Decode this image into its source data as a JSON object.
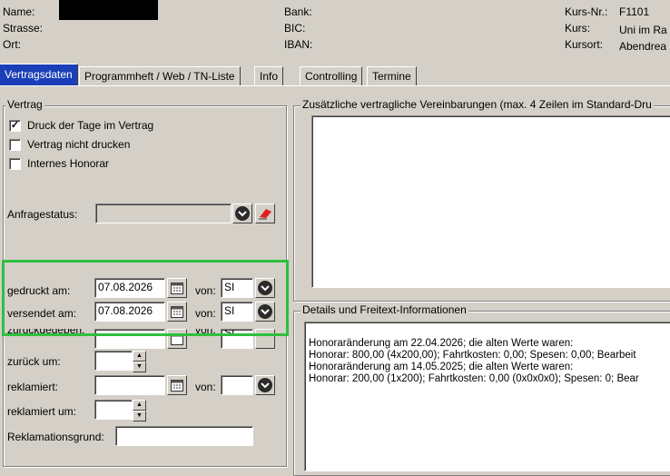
{
  "header": {
    "name_label": "Name:",
    "strasse_label": "Strasse:",
    "ort_label": "Ort:",
    "bank_label": "Bank:",
    "bic_label": "BIC:",
    "iban_label": "IBAN:",
    "kursnr_label": "Kurs-Nr.:",
    "kursnr_value": "F1101",
    "kurs_label": "Kurs:",
    "kurs_value": "Uni im Ra",
    "kursort_label": "Kursort:",
    "kursort_value": "Abendrea"
  },
  "tabs": [
    "Vertragsdaten",
    "Programmheft / Web / TN-Liste",
    "Info",
    "Controlling",
    "Termine"
  ],
  "vertrag": {
    "legend": "Vertrag",
    "checkboxes": [
      {
        "label": "Druck der Tage im Vertrag",
        "checked": true
      },
      {
        "label": "Vertrag nicht drucken",
        "checked": false
      },
      {
        "label": "Internes Honorar",
        "checked": false
      }
    ],
    "anfragestatus_label": "Anfragestatus:",
    "gedruckt_label": "gedruckt am:",
    "gedruckt_date": "07.08.2026",
    "gedruckt_von_label": "von:",
    "gedruckt_von": "SI",
    "versendet_label": "versendet am:",
    "versendet_date": "07.08.2026",
    "versendet_von_label": "von:",
    "versendet_von": "SI",
    "zurueck_label": "zurückgegeben:",
    "zurueck_von_label": "von:",
    "zurueck_von": "SI",
    "zurueck_um_label": "zurück um:",
    "reklamiert_label": "reklamiert:",
    "reklamiert_von_label": "von:",
    "reklamiert_um_label": "reklamiert um:",
    "reklamationsgrund_label": "Reklamationsgrund:"
  },
  "zusatz": {
    "legend": "Zusätzliche vertragliche Vereinbarungen (max. 4 Zeilen im Standard-Dru"
  },
  "details": {
    "legend": "Details und Freitext-Informationen",
    "lines": [
      "Honoraränderung am 22.04.2026; die alten Werte waren:",
      "Honorar: 800,00 (4x200,00); Fahrtkosten: 0,00; Spesen: 0,00; Bearbeit",
      "Honoraränderung am 14.05.2025; die alten Werte waren:",
      "Honorar: 200,00 (1x200); Fahrtkosten: 0,00 (0x0x0x0); Spesen: 0; Bear"
    ]
  },
  "colors": {
    "active_tab": "#1a3fb8",
    "highlight": "#2fbf3f",
    "eraser": "#e0201e"
  }
}
